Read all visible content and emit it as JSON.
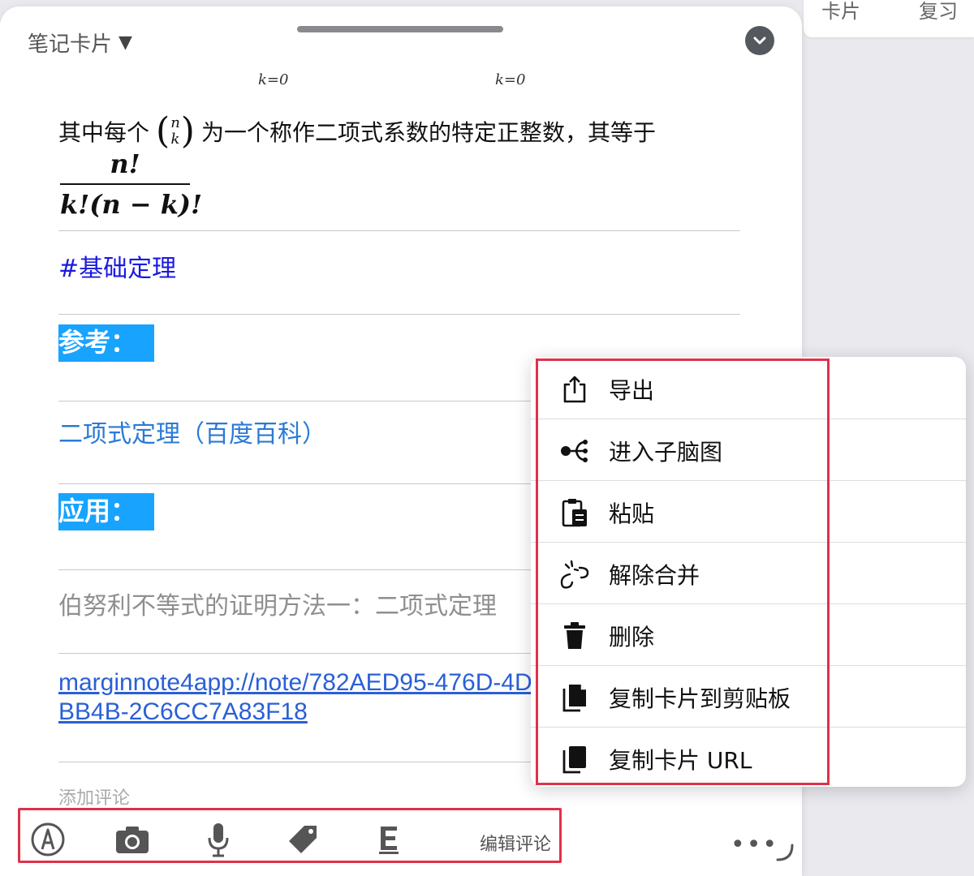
{
  "background_tabs": [
    "卡片",
    "复习"
  ],
  "panel": {
    "title": "笔记卡片",
    "title_caret": "▼"
  },
  "content": {
    "cut_fragment": "k=0",
    "formula_prefix": "其中每个",
    "binom_top": "n",
    "binom_bottom": "k",
    "formula_suffix": "为一个称作二项式系数的特定正整数，其等于",
    "frac_numerator": "n!",
    "frac_denominator": "k!(n − k)!",
    "tag": "#基础定理",
    "heading_reference": "参考：",
    "reference_link": "二项式定理（百度百科）",
    "heading_application": "应用：",
    "application_text": "伯努利不等式的证明方法一：二项式定理",
    "url": "marginnote4app://note/782AED95-476D-4DBB4B-2C6CC7A83F18",
    "add_comment": "添加评论"
  },
  "toolbar": {
    "tools": [
      "pen-icon",
      "camera-icon",
      "microphone-icon",
      "tag-icon",
      "text-format-icon"
    ],
    "edit_comment": "编辑评论",
    "more": "•••"
  },
  "menu": {
    "items": [
      {
        "label": "导出",
        "icon": "share-icon"
      },
      {
        "label": "进入子脑图",
        "icon": "mindmap-icon"
      },
      {
        "label": "粘贴",
        "icon": "paste-icon"
      },
      {
        "label": "解除合并",
        "icon": "unlink-icon"
      },
      {
        "label": "删除",
        "icon": "trash-icon"
      },
      {
        "label": "复制卡片到剪贴板",
        "icon": "copy-icon"
      },
      {
        "label": "复制卡片 URL",
        "icon": "copy-url-icon"
      }
    ]
  },
  "colors": {
    "highlight": "#18a3ff",
    "tag": "#1a1ae0",
    "link": "#2a7ad6",
    "annotation_border": "#e0314a"
  }
}
